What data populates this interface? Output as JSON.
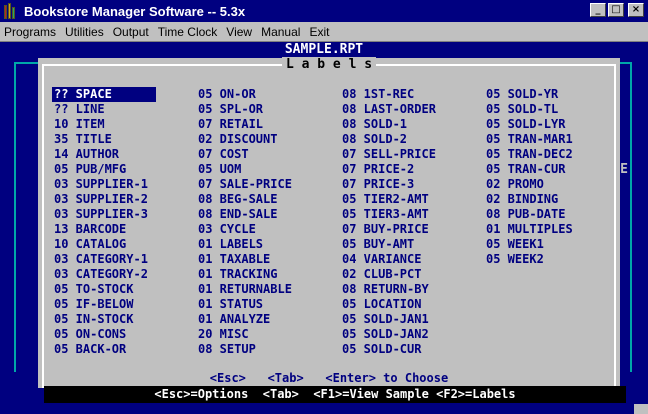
{
  "window": {
    "title": "Bookstore Manager Software -- 5.3x",
    "buttons": {
      "minimize": "_",
      "maximize": "□",
      "close": "×"
    }
  },
  "menu": [
    "Programs",
    "Utilities",
    "Output",
    "Time Clock",
    "View",
    "Manual",
    "Exit"
  ],
  "report": {
    "title": "SAMPLE.RPT"
  },
  "dialog": {
    "title": "L a b e l s",
    "selected": "?? SPACE",
    "columns": [
      [
        "?? SPACE",
        "?? LINE",
        "10 ITEM",
        "35 TITLE",
        "14 AUTHOR",
        "05 PUB/MFG",
        "03 SUPPLIER-1",
        "03 SUPPLIER-2",
        "03 SUPPLIER-3",
        "13 BARCODE",
        "10 CATALOG",
        "03 CATEGORY-1",
        "03 CATEGORY-2",
        "05 TO-STOCK",
        "05 IF-BELOW",
        "05 IN-STOCK",
        "05 ON-CONS",
        "05 BACK-OR"
      ],
      [
        "05 ON-OR",
        "05 SPL-OR",
        "07 RETAIL",
        "02 DISCOUNT",
        "07 COST",
        "05 UOM",
        "07 SALE-PRICE",
        "08 BEG-SALE",
        "08 END-SALE",
        "03 CYCLE",
        "01 LABELS",
        "01 TAXABLE",
        "01 TRACKING",
        "01 RETURNABLE",
        "01 STATUS",
        "01 ANALYZE",
        "20 MISC",
        "08 SETUP"
      ],
      [
        "08 1ST-REC",
        "08 LAST-ORDER",
        "08 SOLD-1",
        "08 SOLD-2",
        "07 SELL-PRICE",
        "07 PRICE-2",
        "07 PRICE-3",
        "05 TIER2-AMT",
        "05 TIER3-AMT",
        "07 BUY-PRICE",
        "05 BUY-AMT",
        "04 VARIANCE",
        "02 CLUB-PCT",
        "08 RETURN-BY",
        "05 LOCATION",
        "05 SOLD-JAN1",
        "05 SOLD-JAN2",
        "05 SOLD-CUR"
      ],
      [
        "05 SOLD-YR",
        "05 SOLD-TL",
        "05 SOLD-LYR",
        "05 TRAN-MAR1",
        "05 TRAN-DEC2",
        "05 TRAN-CUR",
        "02 PROMO",
        "02 BINDING",
        "08 PUB-DATE",
        "01 MULTIPLES",
        "05 WEEK1",
        "05 WEEK2"
      ]
    ],
    "footer": "<Esc>   <Tab>   <Enter> to Choose"
  },
  "statusbar": "<Esc>=Options  <Tab>  <F1>=View Sample <F2>=Labels",
  "edge_char": "E",
  "colors": {
    "console_bg": "#000080",
    "dialog_bg": "#c0c0c0",
    "label_text": "#000080",
    "frame": "#00a8a8"
  }
}
